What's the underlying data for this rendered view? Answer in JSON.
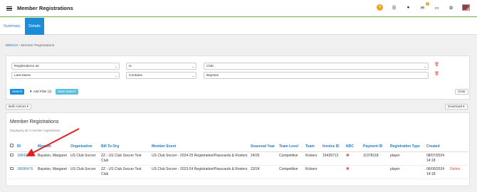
{
  "app": {
    "title": "Member Registrations",
    "message_badge": "1"
  },
  "tabs": {
    "summary": "Summary",
    "details": "Details"
  },
  "breadcrumb": {
    "link": "BB8413",
    "sep": "›",
    "current": "Member Registrations"
  },
  "filters": [
    {
      "field": "Registrations as:",
      "operator": "Is",
      "value": "Club",
      "value_is_select": true
    },
    {
      "field": "Last Name",
      "operator": "Contains",
      "value": "Bayston",
      "value_is_select": false
    }
  ],
  "filter_buttons": {
    "search": "Search",
    "add_filter": "▼ Add Filter (2)",
    "save_search": "Save Search",
    "clear": "Clear"
  },
  "toolbar": {
    "bulk_actions": "Bulk Actions ▾",
    "download": "Download ▾"
  },
  "results": {
    "title": "Member Registrations",
    "subtitle": "Displaying all 2 member registrations",
    "columns": [
      "ID",
      "Member",
      "Organization",
      "Bill To Org",
      "Member Event",
      "Seasonal Year",
      "Team Level",
      "Team",
      "Invoice ID",
      "NDC",
      "Payment ID",
      "Registration Type",
      "Created",
      ""
    ],
    "rows": [
      {
        "id": "18843465",
        "member": "Bayston, Margaret",
        "organization": "US Club Soccer",
        "bill_to": "ZZ - US Club Soccer Test Club",
        "event": "US Club Soccer - 2024-25 Registration/Passcards & Rosters",
        "season": "24/25",
        "level": "Competitive",
        "team": "Kickers",
        "invoice": "15439712",
        "ndc": "✖",
        "payment": "11978118",
        "reg_type": "player",
        "created": "08/07/2024 14:18",
        "action": ""
      },
      {
        "id": "18086476",
        "member": "Bayston, Margaret",
        "organization": "US Club Soccer",
        "bill_to": "ZZ - US Club Soccer Test Club",
        "event": "US Club Soccer - 2023-24 Registration/Passcards & Rosters",
        "season": "23/24",
        "level": "Competitive",
        "team": "Kickers",
        "invoice": "",
        "ndc": "✖",
        "payment": "",
        "reg_type": "player",
        "created": "06/05/2024 14:18",
        "action": "Delete"
      }
    ]
  },
  "icons": {
    "menu": "hamburger-icon",
    "help": "help-icon",
    "list": "list-icon",
    "user": "user-icon",
    "mail": "mail-icon",
    "chat": "chat-icon",
    "settings": "gear-icon"
  },
  "colors": {
    "accent": "#1a8cd8",
    "top_border": "#7ab648",
    "danger": "#d9534f",
    "annotation_arrow": "#e02020"
  }
}
